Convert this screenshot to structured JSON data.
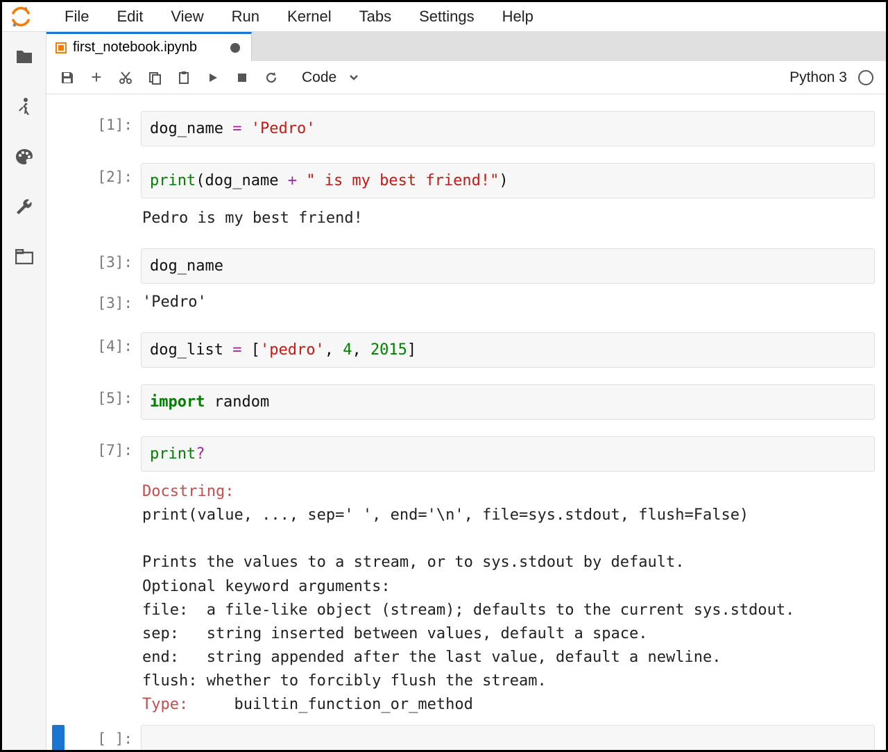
{
  "menubar": [
    "File",
    "Edit",
    "View",
    "Run",
    "Kernel",
    "Tabs",
    "Settings",
    "Help"
  ],
  "tab": {
    "title": "first_notebook.ipynb",
    "dirty": true
  },
  "toolbar": {
    "cell_type": "Code",
    "kernel": "Python 3"
  },
  "prompts": {
    "c1": "[1]:",
    "c2": "[2]:",
    "c3": "[3]:",
    "c3o": "[3]:",
    "c4": "[4]:",
    "c5": "[5]:",
    "c7": "[7]:",
    "blank": "[ ]:"
  },
  "cells": {
    "c1": {
      "var": "dog_name",
      "op": " = ",
      "str": "'Pedro'"
    },
    "c2": {
      "func": "print",
      "lp": "(",
      "arg1": "dog_name",
      "plus": " + ",
      "str": "\" is my best friend!\"",
      "rp": ")",
      "output": "Pedro is my best friend!"
    },
    "c3": {
      "code": "dog_name",
      "output": "'Pedro'"
    },
    "c4": {
      "var": "dog_list",
      "op": " = ",
      "lb": "[",
      "s1": "'pedro'",
      "comma1": ", ",
      "n1": "4",
      "comma2": ", ",
      "n2": "2015",
      "rb": "]"
    },
    "c5": {
      "kw": "import",
      "sp": " ",
      "mod": "random"
    },
    "c7": {
      "func": "print",
      "q": "?",
      "doc_label": "Docstring:",
      "sig": "print(value, ..., sep=' ', end='\\n', file=sys.stdout, flush=False)",
      "l1": "Prints the values to a stream, or to sys.stdout by default.",
      "l2": "Optional keyword arguments:",
      "l3": "file:  a file-like object (stream); defaults to the current sys.stdout.",
      "l4": "sep:   string inserted between values, default a space.",
      "l5": "end:   string appended after the last value, default a newline.",
      "l6": "flush: whether to forcibly flush the stream.",
      "type_label": "Type:     ",
      "type_value": "builtin_function_or_method"
    }
  }
}
